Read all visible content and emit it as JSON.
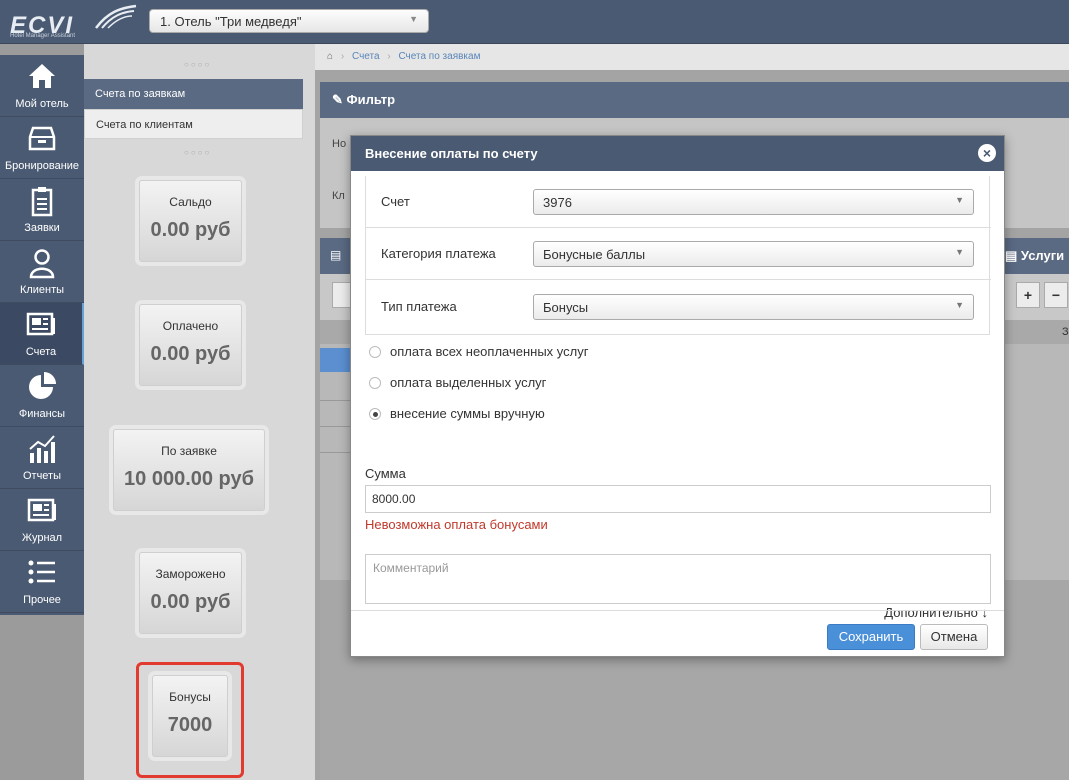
{
  "app": {
    "logo_text": "ECVI",
    "logo_tagline": "Hotel Manager Assistant",
    "hotel_select": "1. Отель \"Три медведя\""
  },
  "nav": {
    "items": [
      {
        "label": "Мой отель",
        "icon": "home-icon"
      },
      {
        "label": "Бронирование",
        "icon": "archive-icon"
      },
      {
        "label": "Заявки",
        "icon": "clipboard-icon"
      },
      {
        "label": "Клиенты",
        "icon": "user-icon"
      },
      {
        "label": "Счета",
        "icon": "invoice-icon"
      },
      {
        "label": "Финансы",
        "icon": "pie-chart-icon"
      },
      {
        "label": "Отчеты",
        "icon": "bar-chart-icon"
      },
      {
        "label": "Журнал",
        "icon": "journal-icon"
      },
      {
        "label": "Прочее",
        "icon": "list-icon"
      }
    ]
  },
  "subnav": {
    "items": [
      "Счета по заявкам",
      "Счета по клиентам"
    ]
  },
  "stats": [
    {
      "title": "Сальдо",
      "value": "0.00 руб"
    },
    {
      "title": "Оплачено",
      "value": "0.00 руб"
    },
    {
      "title": "По заявке",
      "value": "10 000.00 руб"
    },
    {
      "title": "Заморожено",
      "value": "0.00 руб"
    },
    {
      "title": "Бонусы",
      "value": "7000"
    }
  ],
  "breadcrumb": [
    "Счета",
    "Счета по заявкам"
  ],
  "filter": {
    "title": "Фильтр",
    "label_1": "Но",
    "label_2": "Кл"
  },
  "services": {
    "title": "Услуги",
    "column_hint": "З"
  },
  "modal": {
    "title": "Внесение оплаты по счету",
    "fields": [
      {
        "label": "Счет",
        "value": "3976"
      },
      {
        "label": "Категория платежа",
        "value": "Бонусные баллы"
      },
      {
        "label": "Тип платежа",
        "value": "Бонусы"
      }
    ],
    "radios": [
      {
        "label": "оплата всех неоплаченных услуг",
        "checked": false
      },
      {
        "label": "оплата выделенных услуг",
        "checked": false
      },
      {
        "label": "внесение суммы вручную",
        "checked": true
      }
    ],
    "sum_label": "Сумма",
    "sum_value": "8000.00",
    "error": "Невозможна оплата бонусами",
    "comment_placeholder": "Комментарий",
    "more_label": "Дополнительно",
    "save_label": "Сохранить",
    "cancel_label": "Отмена"
  },
  "colors": {
    "nav_bg": "#4a5a72",
    "primary_button": "#4a90d9",
    "error": "#c0392b",
    "highlight": "#e23a2e"
  }
}
